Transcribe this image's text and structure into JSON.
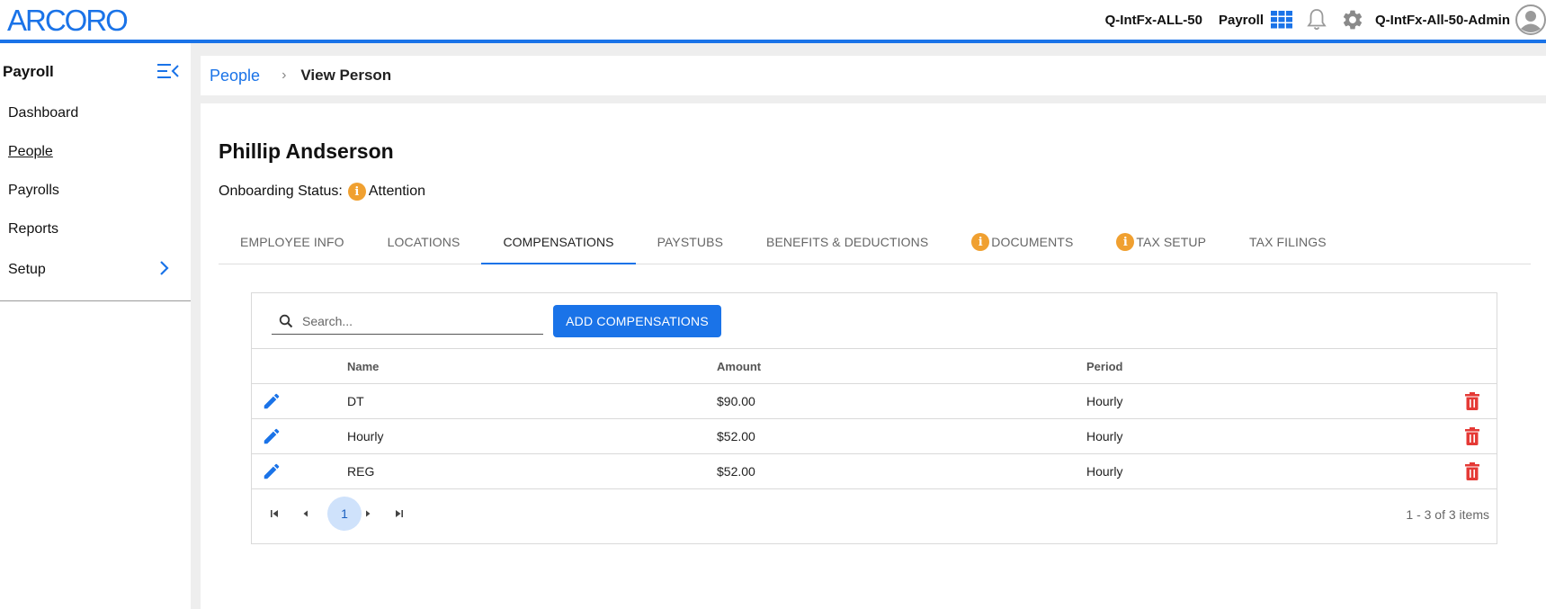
{
  "brand": {
    "logo_text": "ARCORO",
    "accent_color": "#1a73e8"
  },
  "header": {
    "company": "Q-IntFx-ALL-50",
    "product": "Payroll",
    "user": "Q-IntFx-All-50-Admin",
    "icons": [
      "app-grid-icon",
      "bell-icon",
      "gear-icon",
      "avatar-icon"
    ]
  },
  "sidebar": {
    "title": "Payroll",
    "items": [
      {
        "label": "Dashboard"
      },
      {
        "label": "People"
      },
      {
        "label": "Payrolls"
      },
      {
        "label": "Reports"
      },
      {
        "label": "Setup"
      }
    ],
    "active": "People"
  },
  "breadcrumb": {
    "parent": "People",
    "current": "View Person"
  },
  "person": {
    "name": "Phillip Andserson",
    "onboarding_label": "Onboarding Status:",
    "onboarding_status": "Attention",
    "status_color": "#f0a030"
  },
  "tabs": [
    {
      "label": "EMPLOYEE INFO"
    },
    {
      "label": "LOCATIONS"
    },
    {
      "label": "COMPENSATIONS"
    },
    {
      "label": "PAYSTUBS"
    },
    {
      "label": "BENEFITS & DEDUCTIONS"
    },
    {
      "label": "DOCUMENTS"
    },
    {
      "label": "TAX SETUP"
    },
    {
      "label": "TAX FILINGS"
    }
  ],
  "active_tab": "COMPENSATIONS",
  "grid": {
    "search_placeholder": "Search...",
    "add_button": "ADD COMPENSATIONS",
    "columns": [
      "Name",
      "Amount",
      "Period"
    ],
    "rows": [
      {
        "name": "DT",
        "amount": "$90.00",
        "period": "Hourly"
      },
      {
        "name": "Hourly",
        "amount": "$52.00",
        "period": "Hourly"
      },
      {
        "name": "REG",
        "amount": "$52.00",
        "period": "Hourly"
      }
    ],
    "delete_color": "#e53935",
    "pager": {
      "current_page": "1",
      "info": "1 - 3 of 3 items"
    }
  }
}
